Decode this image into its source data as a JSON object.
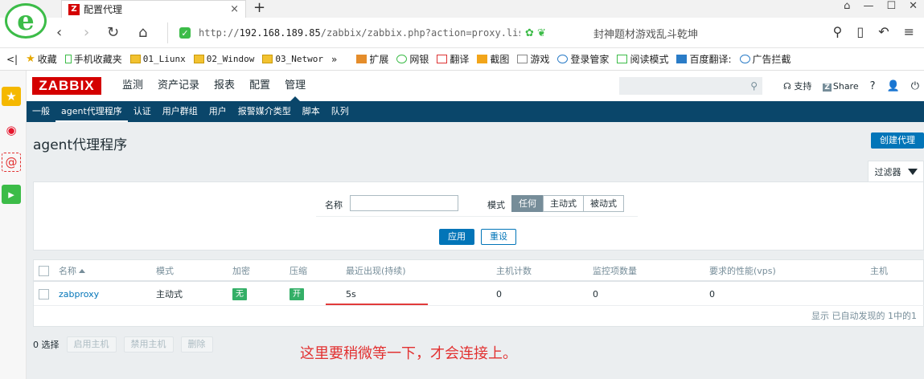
{
  "browser": {
    "tab_title": "配置代理",
    "tab_close": "×",
    "new_tab": "+",
    "url_prefix": "http://",
    "url_host": "192.168.189.85",
    "url_path": "/zabbix/zabbix.php?action=proxy.list",
    "search_hint": "封神题材游戏乱斗乾坤",
    "bookmarks": [
      "收藏",
      "手机收藏夹",
      "01_Liunx",
      "02_Window",
      "03_Networ",
      "»",
      "扩展",
      "网银",
      "翻译",
      "截图",
      "游戏",
      "登录管家",
      "阅读模式",
      "百度翻译:",
      "广告拦截"
    ]
  },
  "zabbix": {
    "logo": "ZABBIX",
    "main_menu": [
      "监测",
      "资产记录",
      "报表",
      "配置",
      "管理"
    ],
    "active_main": 4,
    "header_links": {
      "support": "支持",
      "share_badge": "Z",
      "share": "Share",
      "help": "?"
    },
    "sub_menu": [
      "一般",
      "agent代理程序",
      "认证",
      "用户群组",
      "用户",
      "报警媒介类型",
      "脚本",
      "队列"
    ],
    "active_sub": 1,
    "page_title": "agent代理程序",
    "create_button": "创建代理",
    "filter_tab": "过滤器",
    "filter": {
      "name_label": "名称",
      "name_value": "",
      "mode_label": "模式",
      "modes": [
        "任何",
        "主动式",
        "被动式"
      ],
      "active_mode": 0,
      "apply": "应用",
      "reset": "重设"
    },
    "table": {
      "headers": [
        "名称",
        "模式",
        "加密",
        "压缩",
        "最近出现(持续)",
        "主机计数",
        "监控项数量",
        "要求的性能(vps)",
        "主机"
      ],
      "rows": [
        {
          "name": "zabproxy",
          "mode": "主动式",
          "encryption": "无",
          "compression": "开",
          "last_seen": "5s",
          "hosts": "0",
          "items": "0",
          "vps": "0",
          "host_list": ""
        }
      ],
      "footer": "显示 已自动发现的 1中的1"
    },
    "actions": {
      "selected": "0 选择",
      "enable": "启用主机",
      "disable": "禁用主机",
      "delete": "删除"
    },
    "annotation": "这里要稍微等一下，才会连接上。"
  },
  "colors": {
    "brand": "#d40000",
    "nav": "#0a466a",
    "primary": "#0275b8",
    "ok": "#34af67",
    "annotation": "#e23131"
  }
}
